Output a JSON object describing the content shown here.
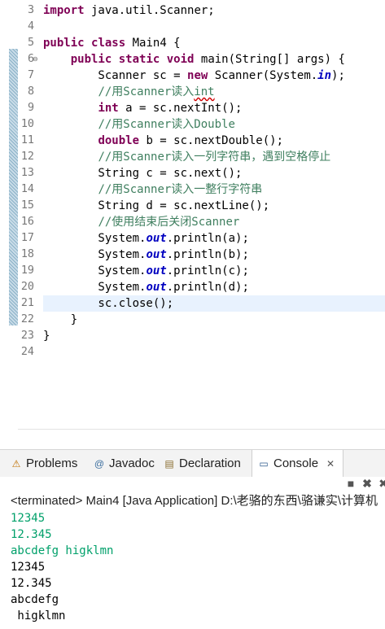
{
  "editor": {
    "lines": [
      {
        "n": "3",
        "tokens": [
          {
            "t": "import",
            "c": "kw"
          },
          {
            "t": " java.util.Scanner;"
          }
        ]
      },
      {
        "n": "4",
        "tokens": []
      },
      {
        "n": "5",
        "tokens": [
          {
            "t": "public",
            "c": "kw"
          },
          {
            "t": " "
          },
          {
            "t": "class",
            "c": "kw"
          },
          {
            "t": " Main4 {"
          }
        ]
      },
      {
        "n": "6",
        "tokens": [
          {
            "t": "    "
          },
          {
            "t": "public",
            "c": "kw"
          },
          {
            "t": " "
          },
          {
            "t": "static",
            "c": "kw"
          },
          {
            "t": " "
          },
          {
            "t": "void",
            "c": "kw"
          },
          {
            "t": " main(String[] args) {"
          }
        ]
      },
      {
        "n": "7",
        "tokens": [
          {
            "t": "        Scanner sc = "
          },
          {
            "t": "new",
            "c": "kw"
          },
          {
            "t": " Scanner(System."
          },
          {
            "t": "in",
            "c": "fld"
          },
          {
            "t": ");"
          }
        ]
      },
      {
        "n": "8",
        "tokens": [
          {
            "t": "        "
          },
          {
            "t": "//用Scanner读入",
            "c": "cm"
          },
          {
            "t": "int",
            "c": "cm sq"
          }
        ]
      },
      {
        "n": "9",
        "tokens": [
          {
            "t": "        "
          },
          {
            "t": "int",
            "c": "kw"
          },
          {
            "t": " a = sc.nextInt();"
          }
        ]
      },
      {
        "n": "10",
        "tokens": [
          {
            "t": "        "
          },
          {
            "t": "//用Scanner读入Double",
            "c": "cm"
          }
        ]
      },
      {
        "n": "11",
        "tokens": [
          {
            "t": "        "
          },
          {
            "t": "double",
            "c": "kw"
          },
          {
            "t": " b = sc.nextDouble();"
          }
        ]
      },
      {
        "n": "12",
        "tokens": [
          {
            "t": "        "
          },
          {
            "t": "//用Scanner读入一列字符串，遇到空格停止",
            "c": "cm"
          }
        ]
      },
      {
        "n": "13",
        "tokens": [
          {
            "t": "        String c = sc.next();"
          }
        ]
      },
      {
        "n": "14",
        "tokens": [
          {
            "t": "        "
          },
          {
            "t": "//用Scanner读入一整行字符串",
            "c": "cm"
          }
        ]
      },
      {
        "n": "15",
        "tokens": [
          {
            "t": "        String d = sc.nextLine();"
          }
        ]
      },
      {
        "n": "16",
        "tokens": [
          {
            "t": "        "
          },
          {
            "t": "//使用结束后关闭Scanner",
            "c": "cm"
          }
        ]
      },
      {
        "n": "17",
        "tokens": [
          {
            "t": "        System."
          },
          {
            "t": "out",
            "c": "fld"
          },
          {
            "t": ".println(a);"
          }
        ]
      },
      {
        "n": "18",
        "tokens": [
          {
            "t": "        System."
          },
          {
            "t": "out",
            "c": "fld"
          },
          {
            "t": ".println(b);"
          }
        ]
      },
      {
        "n": "19",
        "tokens": [
          {
            "t": "        System."
          },
          {
            "t": "out",
            "c": "fld"
          },
          {
            "t": ".println(c);"
          }
        ]
      },
      {
        "n": "20",
        "tokens": [
          {
            "t": "        System."
          },
          {
            "t": "out",
            "c": "fld"
          },
          {
            "t": ".println(d);"
          }
        ]
      },
      {
        "n": "21",
        "tokens": [
          {
            "t": "        sc.close();"
          }
        ]
      },
      {
        "n": "22",
        "tokens": [
          {
            "t": "    }"
          }
        ]
      },
      {
        "n": "23",
        "tokens": [
          {
            "t": "}"
          }
        ]
      },
      {
        "n": "24",
        "tokens": []
      }
    ],
    "current_line": "21",
    "folded_line": "6",
    "scroll_left_glyph": "<"
  },
  "tabs": [
    {
      "label": "Problems",
      "icon": "problems-icon",
      "glyph": "⚠",
      "active": false
    },
    {
      "label": "Javadoc",
      "icon": "javadoc-icon",
      "glyph": "@",
      "active": false
    },
    {
      "label": "Declaration",
      "icon": "declaration-icon",
      "glyph": "▤",
      "active": false
    },
    {
      "label": "Console",
      "icon": "console-icon",
      "glyph": "▭",
      "active": true
    }
  ],
  "console": {
    "close_glyph": "✕",
    "terminated": "<terminated> Main4 [Java Application] D:\\老骆的东西\\骆谦实\\计算机",
    "user_input": [
      "12345",
      "12.345",
      "abcdefg higklmn"
    ],
    "output": [
      "12345",
      "12.345",
      "abcdefg",
      " higklmn"
    ]
  },
  "colors": {
    "keyword": "#7f0055",
    "comment": "#3f7f5f",
    "field": "#0000c0",
    "console_input": "#00a06a",
    "current_line": "#e8f2fe"
  }
}
